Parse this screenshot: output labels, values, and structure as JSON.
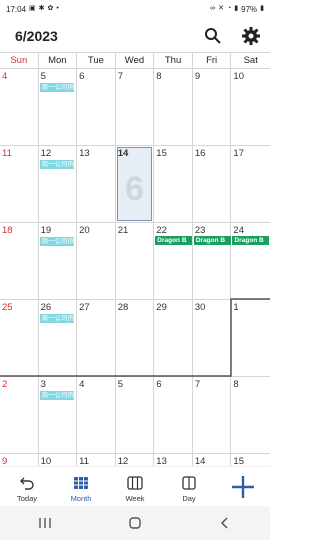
{
  "status_bar": {
    "time": "17:04",
    "battery": "97%"
  },
  "header": {
    "title": "6/2023"
  },
  "weekdays": [
    "Sun",
    "Mon",
    "Tue",
    "Wed",
    "Thu",
    "Fri",
    "Sat"
  ],
  "weeks": [
    {
      "days": [
        "4",
        "5",
        "6",
        "7",
        "8",
        "9",
        "10"
      ]
    },
    {
      "days": [
        "11",
        "12",
        "13",
        "14",
        "15",
        "16",
        "17"
      ]
    },
    {
      "days": [
        "18",
        "19",
        "20",
        "21",
        "22",
        "23",
        "24"
      ]
    },
    {
      "days": [
        "25",
        "26",
        "27",
        "28",
        "29",
        "30",
        "1"
      ]
    },
    {
      "days": [
        "2",
        "3",
        "4",
        "5",
        "6",
        "7",
        "8"
      ]
    },
    {
      "days": [
        "9",
        "10",
        "11",
        "12",
        "13",
        "14",
        "15"
      ]
    }
  ],
  "today": {
    "day_big": "6"
  },
  "events": {
    "weekly": "周一公司例",
    "dragon": "Dragon B"
  },
  "bottom_nav": {
    "today": "Today",
    "month": "Month",
    "week": "Week",
    "day": "Day"
  },
  "colors": {
    "accent": "#2e5ea8",
    "sunday": "#d32f2f",
    "event_cyan": "#80d6e2",
    "event_green": "#1a9f5e"
  }
}
